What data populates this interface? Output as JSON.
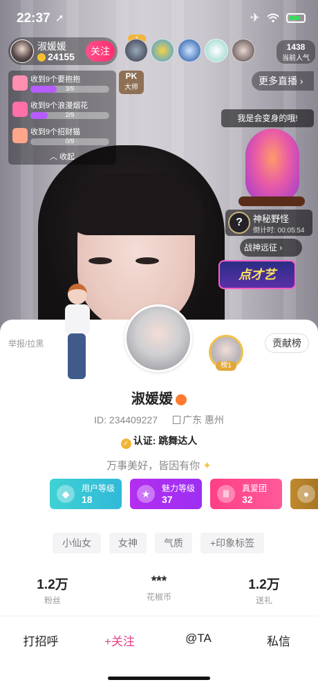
{
  "status_bar": {
    "time": "22:37",
    "location_arrow": "➚",
    "airplane": "✈",
    "wifi": "wifi-icon"
  },
  "host": {
    "name": "淑媛媛",
    "coins": "24155",
    "follow_label": "关注"
  },
  "viewers": {
    "rank_label": "1",
    "popularity_count": "1438",
    "popularity_label": "当前人气"
  },
  "tasks": {
    "items": [
      {
        "label": "收到9个要抱抱",
        "progress": "3/9",
        "fraction": 0.333
      },
      {
        "label": "收到9个浪漫烟花",
        "progress": "2/9",
        "fraction": 0.222
      },
      {
        "label": "收到9个招财猫",
        "progress": "0/9",
        "fraction": 0.0
      }
    ],
    "collapse_label": "收起"
  },
  "pk": {
    "title": "PK",
    "subtitle": "大师"
  },
  "more_live": "更多直播 ›",
  "monster": {
    "bubble_text": "我是会变身的哦!",
    "name": "神秘野怪",
    "timer": "倒计时: 00:05:54",
    "question_mark": "?",
    "expedition_label": "战神远征 ›",
    "talent_label": "点才艺"
  },
  "profile": {
    "report_label": "举报/拉黑",
    "top_fan_tag": "榜1",
    "contrib_label": "贡献榜",
    "name": "淑媛媛",
    "id_text": "ID: 234409227",
    "location": "广东 惠州",
    "verify_text": "认证: 跳舞达人",
    "signature": "万事美好，皆因有你",
    "badges": [
      {
        "label": "用户等级",
        "level": "18",
        "icon": "◆"
      },
      {
        "label": "魅力等级",
        "level": "37",
        "icon": "★"
      },
      {
        "label": "真爱团",
        "level": "32",
        "icon": "Ⅲ"
      },
      {
        "label": "",
        "level": "",
        "icon": "●"
      }
    ],
    "tags": [
      "小仙女",
      "女神",
      "气质",
      "+印象标签"
    ],
    "stats": [
      {
        "value": "1.2万",
        "label": "粉丝"
      },
      {
        "value": "***",
        "label": "花椒币"
      },
      {
        "value": "1.2万",
        "label": "送礼"
      }
    ],
    "actions": [
      "打招呼",
      "+关注",
      "@TA",
      "私信"
    ]
  },
  "colors": {
    "accent_pink": "#e83e86",
    "follow_btn": "#ff2d6f",
    "gold": "#f2b53a",
    "purple_progress": "#b55cff"
  }
}
